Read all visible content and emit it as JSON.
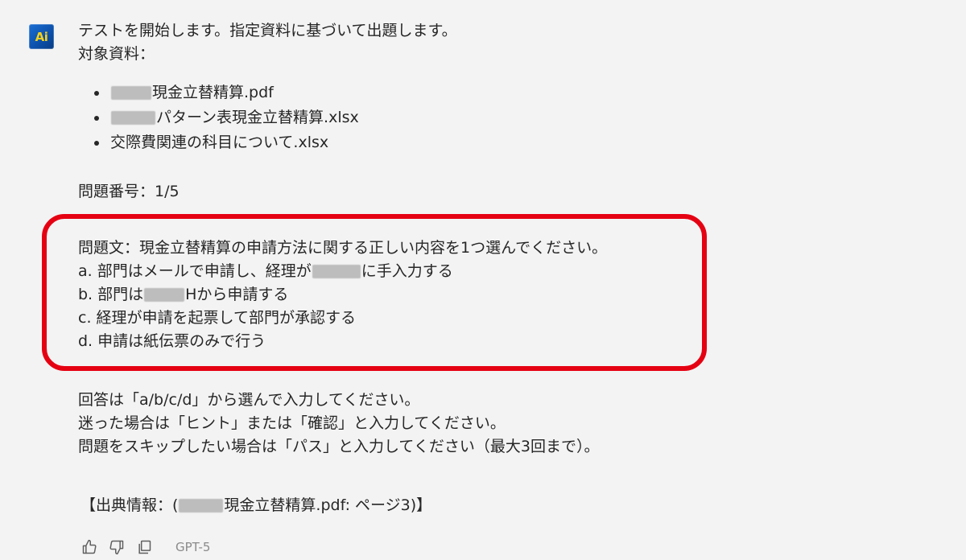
{
  "assistant": {
    "avatar_text": "Ai"
  },
  "message": {
    "intro": "テストを開始します。指定資料に基づいて出題します。",
    "materials_label": "対象資料：",
    "materials": [
      "現金立替精算.pdf",
      "パターン表現金立替精算.xlsx",
      "交際費関連の科目について.xlsx"
    ],
    "question_number": "問題番号：1/5",
    "question": {
      "text": "問題文：現金立替精算の申請方法に関する正しい内容を1つ選んでください。",
      "option_a_pre": "a. 部門はメールで申請し、経理が",
      "option_a_post": "に手入力する",
      "option_b_pre": "b. 部門は",
      "option_b_post": "Hから申請する",
      "option_c": "c. 経理が申請を起票して部門が承認する",
      "option_d": "d. 申請は紙伝票のみで行う"
    },
    "instruction_1": "回答は「a/b/c/d」から選んで入力してください。",
    "instruction_2": "迷った場合は「ヒント」または「確認」と入力してください。",
    "instruction_3": "問題をスキップしたい場合は「パス」と入力してください（最大3回まで）。",
    "source_pre": "【出典情報：(",
    "source_post": "現金立替精算.pdf: ページ3)】"
  },
  "toolbar": {
    "icons": [
      "thumbs-up-icon",
      "thumbs-down-icon",
      "copy-icon"
    ],
    "model": "GPT-5"
  },
  "colors": {
    "highlight_border": "#e50012",
    "background": "#f3f3f3",
    "avatar_bg": "#0b4fa8",
    "avatar_text": "#f4d01c"
  }
}
